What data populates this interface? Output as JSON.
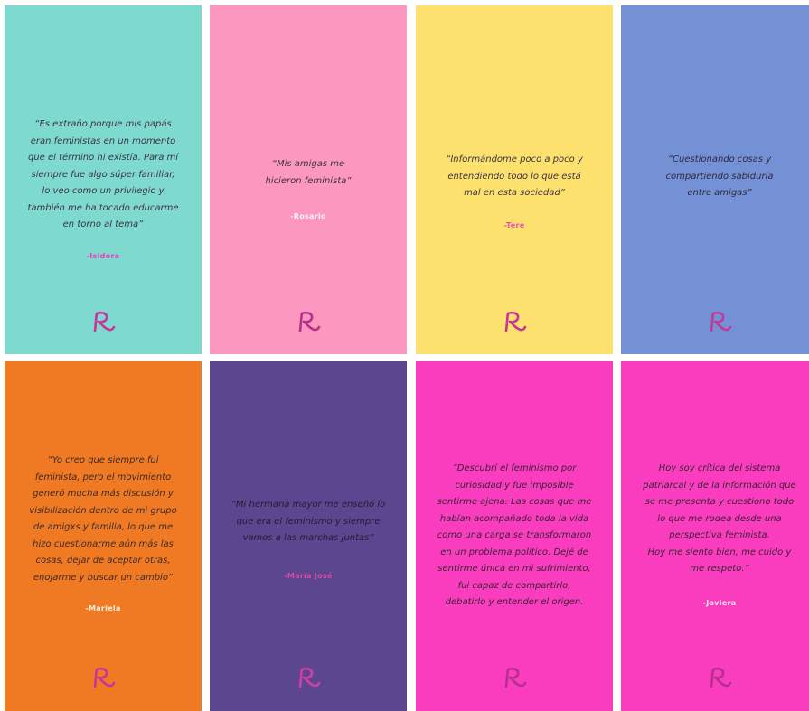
{
  "cards": [
    {
      "bg": "#7edacf",
      "quote_color": "#3d3345",
      "author_color": "#ec3fb8",
      "quote_lines": [
        "“Es extraño porque mis papás",
        "eran feministas en un momento",
        "que el término ni existía. Para mí",
        "siempre fue algo súper familiar,",
        "lo veo como un privilegio y",
        "también me ha tocado educarme",
        "en torno al tema”"
      ],
      "author": "-Isidora",
      "logo_color": "#c9339a",
      "logo_icon": "r-logo-icon"
    },
    {
      "bg": "#fc97bf",
      "quote_color": "#3d3345",
      "author_color": "#f7f2f5",
      "quote_lines": [
        "“Mis amigas me",
        "hicieron feminista”"
      ],
      "author": "-Rosario",
      "logo_color": "#b5308a",
      "logo_icon": "r-logo-icon"
    },
    {
      "bg": "#fde16e",
      "quote_color": "#3d3345",
      "author_color": "#ef4fae",
      "quote_lines": [
        "“Informándome poco a poco y",
        "entendiendo todo lo que está",
        "mal en esta sociedad”"
      ],
      "author": "-Tere",
      "logo_color": "#c9339a",
      "logo_icon": "r-logo-icon"
    },
    {
      "bg": "#7591d6",
      "quote_color": "#2e2a3d",
      "author_color": "#f0f0f8",
      "quote_lines": [
        "“Cuestionando cosas y",
        "compartiendo sabiduría",
        "entre amigas”"
      ],
      "author": "",
      "logo_color": "#c23996",
      "logo_icon": "r-logo-icon"
    },
    {
      "bg": "#f07a24",
      "quote_color": "#3d2a2a",
      "author_color": "#fbefe3",
      "quote_lines": [
        "“Yo creo que siempre fui",
        "feminista, pero el movimiento",
        "generó mucha más discusión y",
        "visibilización dentro de mi grupo",
        "de amigxs y familia, lo que me",
        "hizo cuestionarme aún más las",
        "cosas, dejar de aceptar otras,",
        "enojarme y buscar un cambio”"
      ],
      "author": "-Mariela",
      "logo_color": "#c9339a",
      "logo_icon": "r-logo-icon"
    },
    {
      "bg": "#5b468f",
      "quote_color": "#231c33",
      "author_color": "#d64aa8",
      "quote_lines": [
        "“Mi hermana mayor me enseñó lo",
        "que era el feminismo y siempre",
        "vamos a las marchas juntas”"
      ],
      "author": "-María José",
      "logo_color": "#d13fa6",
      "logo_icon": "r-logo-icon"
    },
    {
      "bg": "#fa3dbe",
      "quote_color": "#3a2436",
      "author_color": "#fbe9f4",
      "quote_lines": [
        "“Descubrí el feminismo por",
        "curiosidad y fue imposible",
        "sentirme ajena. Las cosas que me",
        "habían acompañado toda la vida",
        "como una carga se transformaron",
        "en un problema político. Dejé de",
        "sentirme única en mi sufrimiento,",
        "fui capaz de compartirlo,",
        "debatirlo y entender el origen."
      ],
      "author": "",
      "logo_color": "#b42f8e",
      "logo_icon": "r-logo-icon"
    },
    {
      "bg": "#fa3dbe",
      "quote_color": "#3a2436",
      "author_color": "#fbe9f4",
      "quote_lines": [
        "Hoy soy crítica del sistema",
        "patriarcal y de la información que",
        "se me presenta y cuestiono todo",
        "lo que me rodea desde una",
        "perspectiva feminista.",
        "Hoy me siento bien, me cuido y",
        "me respeto.”"
      ],
      "author": "-Javiera",
      "logo_color": "#b42f8e",
      "logo_icon": "r-logo-icon"
    }
  ]
}
